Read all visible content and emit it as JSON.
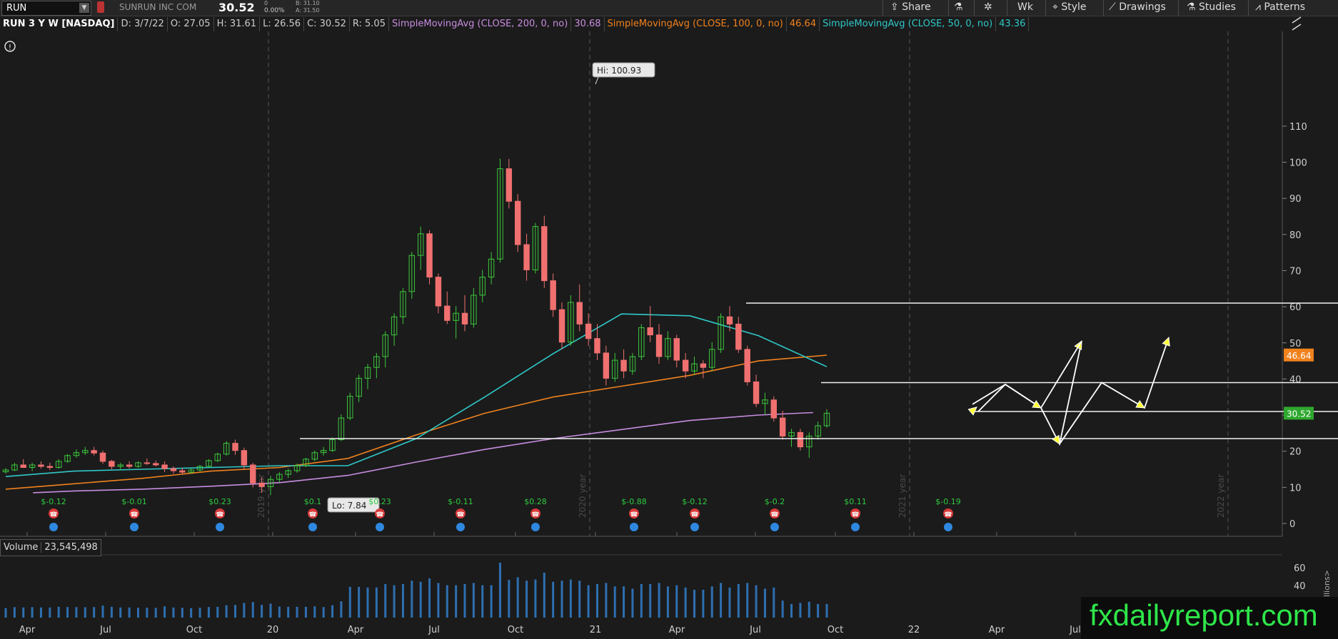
{
  "toolbar": {
    "symbol": "RUN",
    "company": "SUNRUN INC COM",
    "last": "30.52",
    "change_line1": "0",
    "change_line2": "0.00%",
    "bid": "B: 31.10",
    "ask": "A: 31.50",
    "share_label": "Share",
    "aggregation_label": "Wk",
    "style_label": "Style",
    "drawings_label": "Drawings",
    "studies_label": "Studies",
    "patterns_label": "Patterns"
  },
  "infobar": {
    "title": "RUN 3 Y W [NASDAQ]",
    "date": "D: 3/7/22",
    "open": "O: 27.05",
    "high": "H: 31.61",
    "low": "L: 26.56",
    "close": "C: 30.52",
    "range": "R: 5.05",
    "sma200_label": "SimpleMovingAvg (CLOSE, 200, 0, no)",
    "sma200_value": "30.68",
    "sma100_label": "SimpleMovingAvg (CLOSE, 100, 0, no)",
    "sma100_value": "46.64",
    "sma50_label": "SimpleMovingAvg (CLOSE, 50, 0, no)",
    "sma50_value": "43.36"
  },
  "volume_panel": {
    "label": "Volume",
    "value": "23,545,498",
    "ticks": [
      "60",
      "40"
    ],
    "unit_label": "illions>"
  },
  "watermark": "fxdailyreport.com",
  "colors": {
    "sma200": "#c88ce0",
    "sma100": "#f0821e",
    "sma50": "#30c8c8",
    "up_candle": "#3cc83c",
    "down_candle": "#f07070",
    "earnings_icon": "#d83a3a",
    "dividend_icon": "#2e88e0",
    "volume_bar": "#2e6fb0",
    "price_tag": "#2ea82e",
    "sma100_tag": "#f0821e",
    "watermark_text": "#2ee64a"
  },
  "chart_data": {
    "type": "candlestick",
    "ylim": [
      0,
      112
    ],
    "y_ticks": [
      0,
      10,
      20,
      30,
      40,
      50,
      60,
      70,
      80,
      90,
      100,
      110
    ],
    "x_tick_labels": [
      "Apr",
      "Jul",
      "Oct",
      "20",
      "Apr",
      "Jul",
      "Oct",
      "21",
      "Apr",
      "Jul",
      "Oct",
      "22",
      "Apr",
      "Jul"
    ],
    "year_labels": [
      "2019 year",
      "2020 year",
      "2021 year",
      "2022 year"
    ],
    "hi_annotation": "Hi: 100.93",
    "lo_annotation": "Lo: 7.84",
    "last_price_tag": "30.52",
    "sma100_tag": "46.64",
    "earnings": [
      "$-0.12",
      "$-0.01",
      "$0.23",
      "$0.1",
      "$0.23",
      "$-0.11",
      "$0.28",
      "$-0.88",
      "$-0.12",
      "$-0.2",
      "$0.11",
      "$-0.19"
    ],
    "horizontal_levels": [
      61,
      39,
      31,
      23.5
    ],
    "projection_arrow_a": [
      31,
      38.5,
      32,
      22,
      50.5
    ],
    "projection_arrow_b": [
      39,
      32,
      51.5
    ],
    "series": [
      {
        "name": "SimpleMovingAvg (CLOSE, 200, 0, no)",
        "x": [
          0.1,
          0.25,
          0.5,
          0.75,
          1.0,
          1.25,
          1.5,
          1.75,
          2.0,
          2.25,
          2.5,
          2.75,
          2.95
        ],
        "values": [
          8.5,
          9.0,
          9.5,
          10.3,
          11.3,
          13.3,
          17.0,
          20.5,
          23.5,
          26.0,
          28.5,
          30.0,
          30.7
        ]
      },
      {
        "name": "SimpleMovingAvg (CLOSE, 100, 0, no)",
        "x": [
          0.0,
          0.25,
          0.5,
          0.75,
          1.0,
          1.25,
          1.5,
          1.75,
          2.0,
          2.25,
          2.5,
          2.75,
          3.0
        ],
        "values": [
          9.5,
          11.0,
          12.5,
          14.5,
          15.5,
          18.0,
          24.5,
          30.5,
          35.0,
          38.0,
          41.0,
          45.0,
          46.6
        ]
      },
      {
        "name": "SimpleMovingAvg (CLOSE, 50, 0, no)",
        "x": [
          0.0,
          0.25,
          0.5,
          0.75,
          1.0,
          1.25,
          1.5,
          1.75,
          2.0,
          2.25,
          2.5,
          2.75,
          3.0
        ],
        "values": [
          13.0,
          14.5,
          15.0,
          15.5,
          16.0,
          16.0,
          23.5,
          35.0,
          47.0,
          58.0,
          57.5,
          52.0,
          43.4
        ]
      }
    ],
    "candles": [
      [
        14.3,
        15.3,
        13.8,
        14.8
      ],
      [
        14.8,
        16.8,
        14.5,
        16.2
      ],
      [
        16.2,
        17.8,
        15.8,
        15.5
      ],
      [
        15.5,
        16.8,
        14.5,
        16.2
      ],
      [
        16.2,
        17.2,
        15.2,
        15.8
      ],
      [
        15.8,
        16.8,
        14.8,
        15.5
      ],
      [
        15.5,
        17.8,
        15.2,
        17.2
      ],
      [
        17.2,
        19.2,
        16.8,
        18.8
      ],
      [
        18.8,
        20.5,
        18.2,
        19.6
      ],
      [
        19.6,
        21.2,
        19.0,
        20.2
      ],
      [
        20.2,
        21.2,
        18.8,
        19.5
      ],
      [
        19.5,
        20.2,
        16.5,
        17.2
      ],
      [
        17.2,
        17.6,
        15.0,
        15.8
      ],
      [
        15.8,
        16.8,
        14.8,
        16.2
      ],
      [
        16.2,
        17.2,
        15.2,
        15.8
      ],
      [
        15.8,
        17.2,
        15.4,
        16.8
      ],
      [
        16.8,
        18.0,
        16.2,
        16.6
      ],
      [
        16.6,
        17.4,
        15.8,
        16.2
      ],
      [
        16.2,
        17.2,
        14.2,
        15.2
      ],
      [
        15.2,
        15.8,
        13.8,
        14.6
      ],
      [
        14.6,
        15.4,
        13.6,
        14.2
      ],
      [
        14.2,
        15.2,
        13.8,
        14.8
      ],
      [
        14.8,
        16.2,
        14.4,
        15.8
      ],
      [
        15.8,
        17.8,
        15.4,
        17.4
      ],
      [
        17.4,
        19.6,
        17.0,
        19.2
      ],
      [
        19.2,
        22.8,
        18.8,
        22.2
      ],
      [
        22.2,
        23.2,
        19.0,
        20.2
      ],
      [
        20.2,
        21.0,
        15.0,
        16.2
      ],
      [
        16.2,
        16.8,
        10.0,
        11.2
      ],
      [
        11.2,
        12.8,
        8.5,
        10.2
      ],
      [
        10.2,
        13.2,
        7.84,
        12.2
      ],
      [
        12.2,
        14.2,
        11.4,
        13.6
      ],
      [
        13.6,
        15.2,
        12.6,
        14.6
      ],
      [
        14.6,
        16.6,
        14.0,
        16.0
      ],
      [
        16.0,
        18.2,
        15.6,
        17.8
      ],
      [
        17.8,
        20.2,
        17.2,
        19.6
      ],
      [
        19.6,
        21.2,
        18.8,
        20.2
      ],
      [
        20.2,
        23.8,
        19.8,
        23.2
      ],
      [
        23.2,
        30.2,
        22.8,
        29.2
      ],
      [
        29.2,
        36.2,
        28.6,
        35.2
      ],
      [
        35.2,
        41.2,
        33.6,
        40.2
      ],
      [
        40.2,
        44.2,
        37.2,
        43.2
      ],
      [
        43.2,
        47.2,
        40.2,
        46.2
      ],
      [
        46.2,
        53.2,
        43.2,
        52.2
      ],
      [
        52.2,
        58.2,
        49.2,
        57.2
      ],
      [
        57.2,
        65.2,
        55.2,
        64.2
      ],
      [
        64.2,
        75.2,
        62.2,
        74.2
      ],
      [
        74.2,
        82.2,
        70.2,
        80.2
      ],
      [
        80.2,
        81.2,
        66.2,
        68.2
      ],
      [
        68.2,
        69.2,
        58.2,
        60.2
      ],
      [
        60.2,
        64.2,
        55.2,
        56.2
      ],
      [
        56.2,
        60.2,
        51.2,
        58.2
      ],
      [
        58.2,
        63.2,
        53.2,
        55.2
      ],
      [
        55.2,
        65.2,
        54.2,
        63.2
      ],
      [
        63.2,
        70.2,
        61.2,
        68.2
      ],
      [
        68.2,
        75.2,
        66.2,
        73.2
      ],
      [
        73.2,
        101.0,
        72.2,
        98.2
      ],
      [
        98.2,
        100.93,
        87.2,
        89.2
      ],
      [
        89.2,
        91.2,
        75.2,
        77.2
      ],
      [
        77.2,
        80.2,
        67.2,
        70.2
      ],
      [
        70.2,
        83.2,
        69.2,
        82.2
      ],
      [
        82.2,
        85.2,
        65.2,
        67.2
      ],
      [
        67.2,
        69.2,
        57.2,
        59.2
      ],
      [
        59.2,
        61.2,
        48.2,
        50.2
      ],
      [
        50.2,
        63.2,
        49.2,
        61.2
      ],
      [
        61.2,
        66.2,
        53.2,
        55.2
      ],
      [
        55.2,
        58.2,
        49.2,
        51.2
      ],
      [
        51.2,
        55.2,
        45.2,
        47.2
      ],
      [
        47.2,
        49.2,
        38.2,
        40.2
      ],
      [
        40.2,
        47.2,
        39.2,
        45.2
      ],
      [
        45.2,
        48.2,
        40.2,
        42.2
      ],
      [
        42.2,
        47.2,
        41.2,
        46.2
      ],
      [
        46.2,
        55.2,
        45.2,
        54.2
      ],
      [
        54.2,
        60.2,
        50.2,
        52.2
      ],
      [
        52.2,
        55.2,
        44.2,
        46.2
      ],
      [
        46.2,
        53.2,
        45.2,
        51.2
      ],
      [
        51.2,
        52.2,
        43.2,
        45.2
      ],
      [
        45.2,
        47.2,
        40.2,
        42.2
      ],
      [
        42.2,
        46.2,
        41.2,
        44.2
      ],
      [
        44.2,
        45.2,
        40.2,
        43.2
      ],
      [
        43.2,
        50.2,
        42.2,
        48.2
      ],
      [
        48.2,
        58.2,
        47.2,
        57.2
      ],
      [
        57.2,
        60.2,
        53.2,
        55.2
      ],
      [
        55.2,
        57.2,
        47.2,
        48.2
      ],
      [
        48.2,
        49.2,
        38.2,
        39.2
      ],
      [
        39.2,
        41.2,
        32.2,
        33.2
      ],
      [
        33.2,
        36.2,
        30.2,
        34.2
      ],
      [
        34.2,
        35.2,
        28.2,
        29.2
      ],
      [
        29.2,
        31.2,
        23.2,
        24.2
      ],
      [
        24.2,
        26.2,
        21.2,
        25.2
      ],
      [
        25.2,
        26.2,
        20.2,
        21.2
      ],
      [
        21.2,
        25.2,
        18.2,
        24.2
      ],
      [
        24.2,
        28.2,
        23.2,
        27.05
      ],
      [
        27.05,
        31.61,
        26.56,
        30.52
      ]
    ]
  }
}
